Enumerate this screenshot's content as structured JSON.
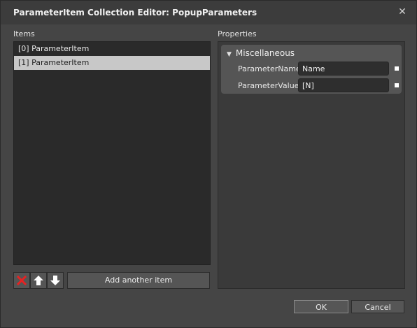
{
  "window": {
    "title": "ParameterItem Collection Editor: PopupParameters",
    "close_glyph": "✕"
  },
  "items_panel": {
    "label": "Items",
    "items": [
      {
        "label": "[0] ParameterItem",
        "selected": false
      },
      {
        "label": "[1] ParameterItem",
        "selected": true
      }
    ],
    "add_label": "Add another item",
    "icons": [
      "delete-icon",
      "move-up-icon",
      "move-down-icon"
    ]
  },
  "properties_panel": {
    "label": "Properties",
    "category": "Miscellaneous",
    "props": [
      {
        "name": "ParameterName",
        "value": "Name"
      },
      {
        "name": "ParameterValue",
        "value": "[N]"
      }
    ]
  },
  "buttons": {
    "ok": "OK",
    "cancel": "Cancel"
  },
  "colors": {
    "delete_icon": "#e52222",
    "arrow_icon": "#ffffff",
    "selected_row": "#c8c8c8"
  }
}
